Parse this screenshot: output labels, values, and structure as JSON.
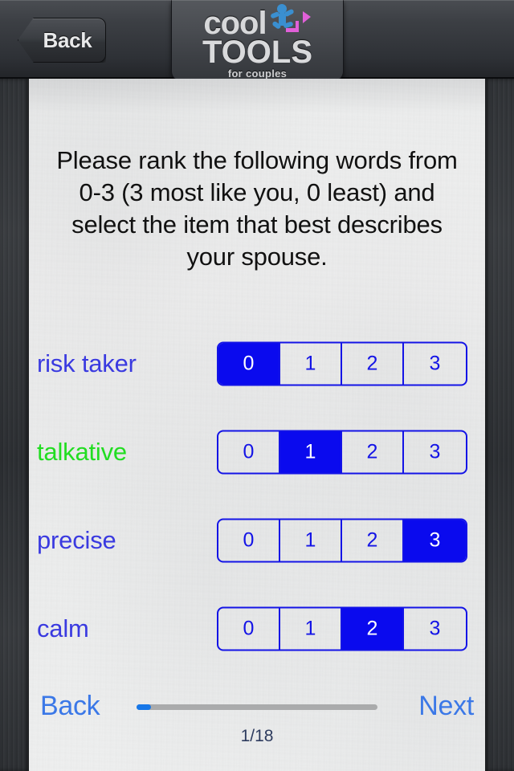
{
  "header": {
    "back_button": {
      "label": "Back",
      "icon": "back-arrow-icon"
    },
    "logo": {
      "line1": "cool",
      "line2": "TOOLS",
      "tagline": "for couples",
      "figure_icon": "person-arrow-icon",
      "figure_color": "#3a8fd0",
      "arrow_color": "#e060d8"
    }
  },
  "main": {
    "instructions": "Please rank the following words from 0-3 (3 most like you, 0 least) and select the item that best describes your spouse.",
    "scale": [
      "0",
      "1",
      "2",
      "3"
    ],
    "rows": [
      {
        "label": "risk taker",
        "selected": 0,
        "label_color": "#3a3ae0",
        "highlighted": false
      },
      {
        "label": "talkative",
        "selected": 1,
        "label_color": "#22dd22",
        "highlighted": true
      },
      {
        "label": "precise",
        "selected": 3,
        "label_color": "#3a3ae0",
        "highlighted": false
      },
      {
        "label": "calm",
        "selected": 2,
        "label_color": "#3a3ae0",
        "highlighted": false
      }
    ]
  },
  "footer": {
    "back_label": "Back",
    "next_label": "Next",
    "counter": "1/18",
    "progress_percent": 6,
    "accent_color": "#3b78e7",
    "progress_fill_color": "#1777e8",
    "progress_track_color": "#aaabac"
  },
  "theme": {
    "selected_fill": "#0a0aee",
    "segment_border": "#1414e6",
    "text_color": "#111111"
  }
}
